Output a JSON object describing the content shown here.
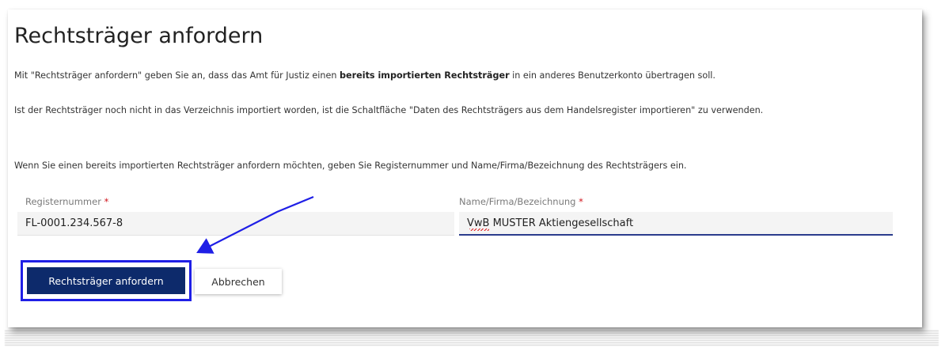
{
  "page": {
    "title": "Rechtsträger anfordern",
    "intro_before": "Mit \"Rechtsträger anfordern\" geben Sie an, dass das Amt für Justiz einen ",
    "intro_bold": "bereits importierten Rechtsträger",
    "intro_after": " in ein anderes Benutzerkonto übertragen soll.",
    "info_text": "Ist der Rechtsträger noch nicht in das Verzeichnis importiert worden, ist die Schaltfläche \"Daten des Rechtsträgers aus dem Handelsregister importieren\" zu verwenden.",
    "instruction_text": "Wenn Sie einen bereits importierten Rechtsträger anfordern möchten, geben Sie Registernummer und Name/Firma/Bezeichnung des Rechtsträgers ein."
  },
  "form": {
    "register_number": {
      "label": "Registernummer",
      "required_marker": "*",
      "value": "FL-0001.234.567-8"
    },
    "name": {
      "label": "Name/Firma/Bezeichnung",
      "required_marker": "*",
      "value": "VwB MUSTER Aktiengesellschaft"
    }
  },
  "actions": {
    "submit_label": "Rechtsträger anfordern",
    "cancel_label": "Abbrechen"
  },
  "colors": {
    "primary_button": "#0d2a6b",
    "highlight_box": "#1f1fe6",
    "arrow": "#1f1fe6",
    "required": "#d0141c"
  }
}
